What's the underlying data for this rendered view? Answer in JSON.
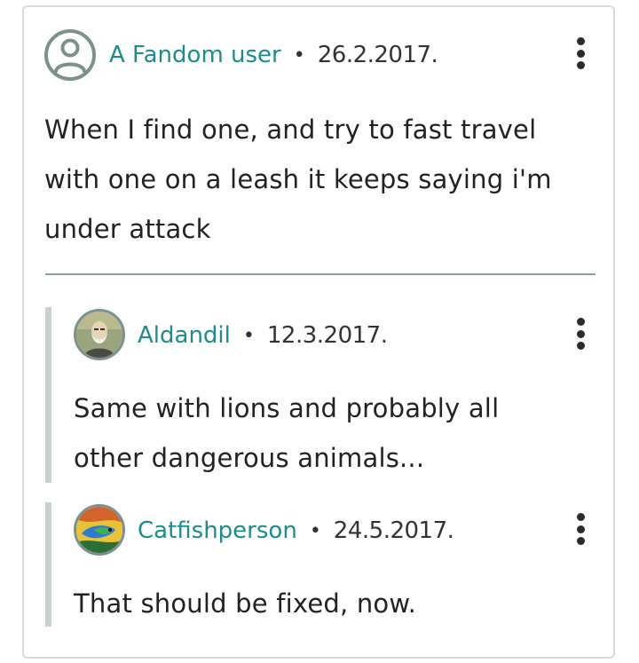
{
  "thread": {
    "main": {
      "author": "A Fandom user",
      "separator": "•",
      "date": "26.2.2017.",
      "text": "When I find one, and try to fast travel with one on a leash it keeps saying i'm under attack"
    },
    "replies": [
      {
        "author": "Aldandil",
        "separator": "•",
        "date": "12.3.2017.",
        "text": "Same with lions and probably all other dangerous animals..."
      },
      {
        "author": "Catfishperson",
        "separator": "•",
        "date": "24.5.2017.",
        "text": "That should be fixed, now."
      }
    ]
  },
  "icons": {
    "default_avatar": "user-circle-icon",
    "options": "more-vertical-icon"
  },
  "colors": {
    "author_link": "#1e8c8c",
    "divider": "#8aa19e",
    "reply_bar": "#c9d1cf",
    "card_border": "#d8dddc"
  }
}
